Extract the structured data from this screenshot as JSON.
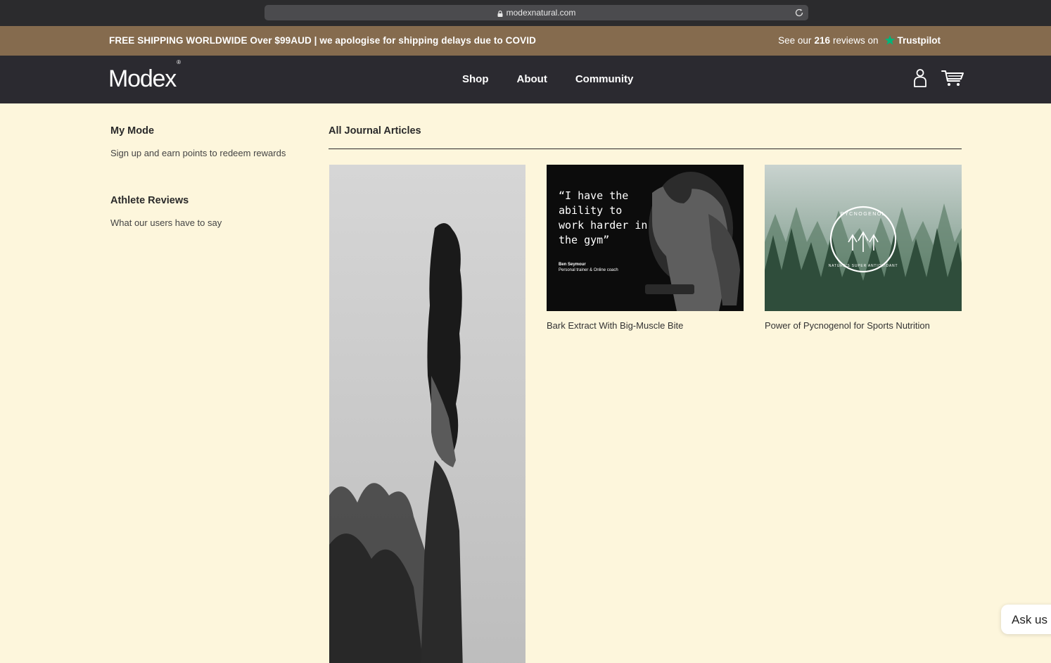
{
  "browser": {
    "url": "modexnatural.com"
  },
  "promo": {
    "shipping": "FREE SHIPPING WORLDWIDE Over $99AUD | we apologise for shipping delays due to COVID",
    "reviews_prefix": "See our",
    "reviews_count": "216",
    "reviews_suffix": "reviews on",
    "trustpilot": "Trustpilot"
  },
  "nav": {
    "logo": "Modex",
    "logo_mark": "®",
    "links": [
      "Shop",
      "About",
      "Community"
    ],
    "icons": [
      "account-icon",
      "cart-icon"
    ]
  },
  "sidebar": {
    "items": [
      {
        "title": "My Mode",
        "desc": "Sign up and earn points to redeem rewards"
      },
      {
        "title": "Athlete Reviews",
        "desc": "What our users have to say"
      }
    ]
  },
  "journal": {
    "title": "All Journal Articles",
    "articles": [
      {
        "caption": ""
      },
      {
        "caption": "Bark Extract With Big-Muscle Bite",
        "quote": "“I have the ability to work harder in the gym”",
        "quote_author": "Ben Seymour",
        "quote_role": "Personal trainer & Online coach"
      },
      {
        "caption": "Power of Pycnogenol for Sports Nutrition",
        "badge_top": "PYCNOGENOL",
        "badge_bottom": "NATURE'S SUPER ANTIOXIDANT"
      }
    ]
  },
  "chat": {
    "label": "Ask us"
  },
  "colors": {
    "promo_bg": "#856b4e",
    "nav_bg": "#2b2a30",
    "page_bg": "#fdf6dc",
    "trustpilot_green": "#00b67a"
  }
}
